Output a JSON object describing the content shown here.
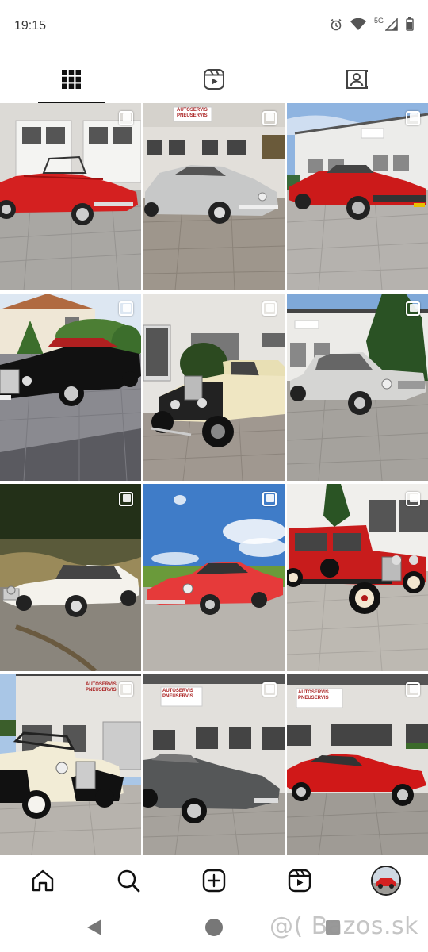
{
  "status": {
    "time": "19:15",
    "network": "5G"
  },
  "tabs": [
    {
      "name": "grid",
      "icon": "grid-icon",
      "active": true
    },
    {
      "name": "reels",
      "icon": "reels-icon",
      "active": false
    },
    {
      "name": "tagged",
      "icon": "tagged-icon",
      "active": false
    }
  ],
  "posts": [
    {
      "sign": "",
      "car": "red-convertible"
    },
    {
      "sign": "AUTOSERVIS PNEUSERVIS",
      "car": "silver-coupe"
    },
    {
      "sign": "",
      "car": "red-jaguar-xjs"
    },
    {
      "sign": "",
      "car": "black-convertible"
    },
    {
      "sign": "",
      "car": "cream-vintage"
    },
    {
      "sign": "",
      "car": "grey-sedan"
    },
    {
      "sign": "",
      "car": "white-pagoda"
    },
    {
      "sign": "",
      "car": "red-porsche"
    },
    {
      "sign": "",
      "car": "red-vintage-sedan"
    },
    {
      "sign": "AUTOSERVIS PNEUSERVIS",
      "car": "cream-cabriolet"
    },
    {
      "sign": "AUTOSERVIS PNEUSERVIS",
      "car": "grey-etype"
    },
    {
      "sign": "AUTOSERVIS PNEUSERVIS",
      "car": "red-etype"
    }
  ],
  "bottom_nav": [
    "home-icon",
    "search-icon",
    "create-icon",
    "reels-icon",
    "profile-avatar"
  ],
  "watermark": "@( Bazos.sk",
  "colors": {
    "accent": "#111111",
    "car_red": "#d42020"
  }
}
